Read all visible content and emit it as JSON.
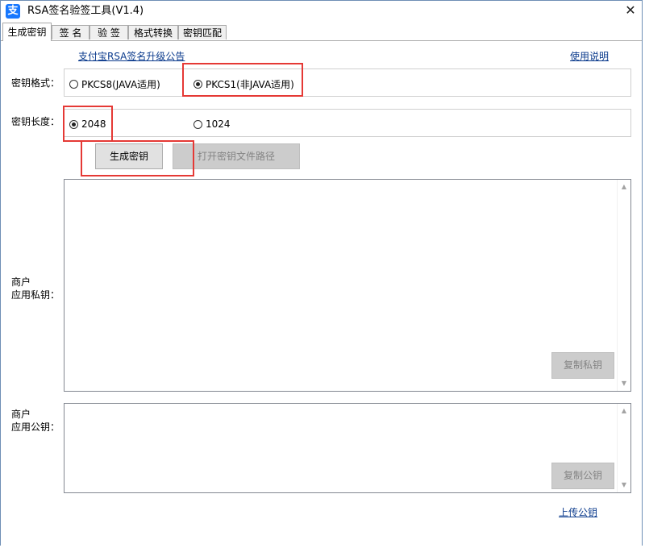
{
  "window": {
    "title": "RSA签名验签工具(V1.4)",
    "icon_char": "支",
    "close_glyph": "✕",
    "accent": "#1677ff"
  },
  "tabs": [
    {
      "label": "生成密钥",
      "active": true
    },
    {
      "label": "签  名",
      "active": false
    },
    {
      "label": "验  签",
      "active": false
    },
    {
      "label": "格式转换",
      "active": false
    },
    {
      "label": "密钥匹配",
      "active": false
    }
  ],
  "links": {
    "announcement": "支付宝RSA签名升级公告",
    "usage": "使用说明",
    "upload_public_key": "上传公钥"
  },
  "key_format": {
    "label": "密钥格式：",
    "options": [
      {
        "label": "PKCS8(JAVA适用)",
        "checked": false
      },
      {
        "label": "PKCS1(非JAVA适用)",
        "checked": true
      }
    ]
  },
  "key_length": {
    "label": "密钥长度：",
    "options": [
      {
        "label": "2048",
        "checked": true
      },
      {
        "label": "1024",
        "checked": false
      }
    ]
  },
  "buttons": {
    "generate": "生成密钥",
    "open_path": "打开密钥文件路径",
    "copy_private": "复制私钥",
    "copy_public": "复制公钥"
  },
  "private_key": {
    "label_line1": "商户",
    "label_line2": "应用私钥：",
    "value": ""
  },
  "public_key": {
    "label_line1": "商户",
    "label_line2": "应用公钥：",
    "value": ""
  },
  "scroll_glyphs": {
    "up": "▲",
    "down": "▼"
  },
  "highlight_color": "#e53935"
}
